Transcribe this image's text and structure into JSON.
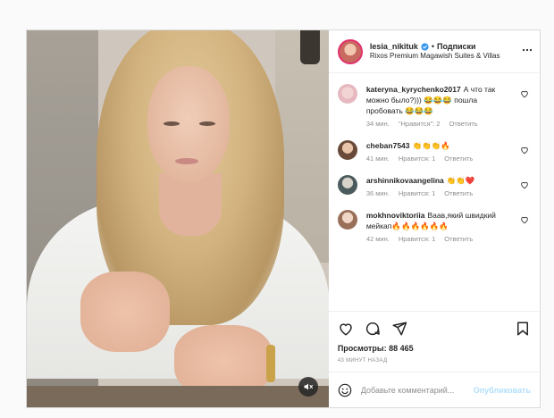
{
  "post": {
    "username": "lesia_nikituk",
    "separator": "•",
    "follow_label": "Подписки",
    "location": "Rixos Premium Magawish Suites & Villas"
  },
  "comments": [
    {
      "user": "kateryna_kyrychenko2017",
      "text": "А что так можно было?))) 😂😂😂 пошла пробовать 😂😂😂",
      "time": "34 мин.",
      "likes": "\"Нравится\": 2",
      "reply": "Ответить"
    },
    {
      "user": "cheban7543",
      "text": "👏👏👏🔥",
      "time": "41 мин.",
      "likes": "Нравится: 1",
      "reply": "Ответить"
    },
    {
      "user": "arshinnikovaangelina",
      "text": "👏👏❤️",
      "time": "36 мин.",
      "likes": "Нравится: 1",
      "reply": "Ответить"
    },
    {
      "user": "mokhnoviktoriia",
      "text": "Ваав,який швидкий мейкап🔥🔥🔥🔥🔥🔥",
      "time": "42 мин.",
      "likes": "Нравится: 1",
      "reply": "Ответить"
    }
  ],
  "stats": {
    "views": "Просмотры: 88 465",
    "posted_ago": "43 МИНУТ НАЗАД"
  },
  "add_comment": {
    "placeholder": "Добавьте комментарий...",
    "publish_label": "Опубликовать"
  },
  "icons": {
    "verified": "verified-badge-icon",
    "more": "more-options-icon",
    "like": "heart-icon",
    "comment": "comment-icon",
    "share": "share-icon",
    "save": "bookmark-icon",
    "emoji": "emoji-icon",
    "mute": "sound-muted-icon"
  },
  "colors": {
    "verified": "#3897f0",
    "publish_disabled": "#b2dffc",
    "meta_text": "#8e8e8e"
  }
}
